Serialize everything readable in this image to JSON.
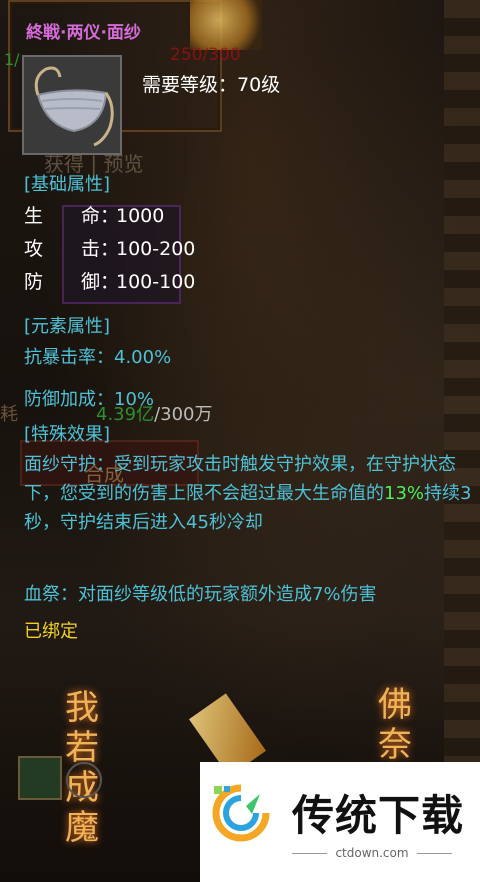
{
  "item": {
    "title": "終戦·两仪·面纱",
    "required_level": "需要等级：70级"
  },
  "background_ghost": {
    "counter": "250/300",
    "left_counter": "1/",
    "preview": "获得 | 预览",
    "money_label": "耗",
    "money_current": "4.39亿",
    "money_max": "/300万",
    "synthesize": "合成"
  },
  "basic_attributes": {
    "header": "[基础属性]",
    "rows": [
      {
        "name": "生　　命：",
        "value": "1000"
      },
      {
        "name": "攻　　击：",
        "value": "100-200"
      },
      {
        "name": "防　　御：",
        "value": "100-100"
      }
    ]
  },
  "element_attributes": {
    "header": "[元素属性]",
    "crit": "抗暴击率：4.00%",
    "defense_bonus": "防御加成：10%"
  },
  "special_effects": {
    "header": "[特殊效果]",
    "guard_prefix": "面纱守护：受到玩家攻击时触发守护效果，在守护状态下，您受到的伤害上限不会超过最大生命值的",
    "guard_pct": "13%",
    "guard_suffix": "持续3秒，守护结束后进入45秒冷却",
    "blood_sacrifice": "血祭：对面纱等级低的玩家额外造成7%伤害",
    "bound": "已绑定"
  },
  "bottom_art": {
    "text_left": "我若成魔",
    "text_right": "佛奈"
  },
  "watermark": {
    "title": "传统下载",
    "url": "ctdown.com"
  },
  "colors": {
    "title": "#d56bd8",
    "attribute_text": "#4ec1d6",
    "highlight": "#4cf05a",
    "bound": "#f2d21f"
  }
}
